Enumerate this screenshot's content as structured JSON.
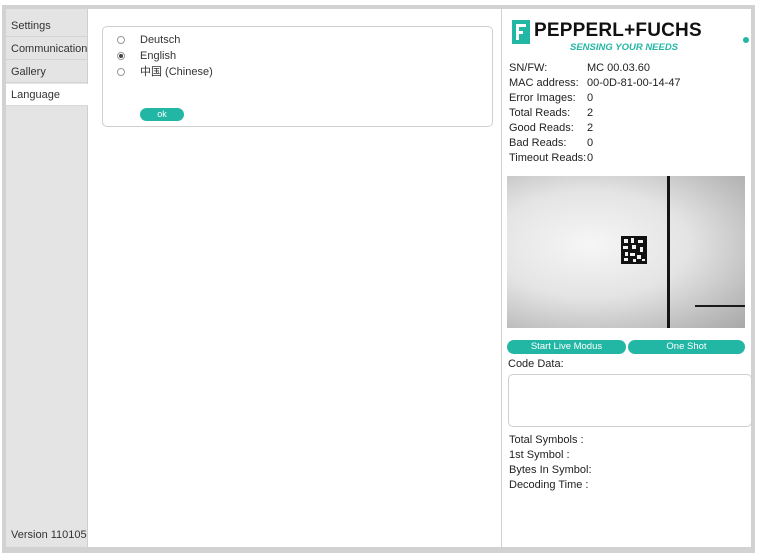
{
  "sidebar": {
    "items": [
      {
        "label": "Settings"
      },
      {
        "label": "Communication"
      },
      {
        "label": "Gallery"
      },
      {
        "label": "Language",
        "active": true
      }
    ],
    "version": "Version 110105"
  },
  "language": {
    "options": [
      {
        "label": "Deutsch",
        "selected": false
      },
      {
        "label": "English",
        "selected": true
      },
      {
        "label": "中国 (Chinese)",
        "selected": false
      }
    ],
    "ok_label": "ok"
  },
  "brand": {
    "name": "PEPPERL+FUCHS",
    "tagline": "SENSING YOUR NEEDS",
    "accent": "#22b7a4",
    "logo_icon": "pf-logo-icon",
    "status_icon": "status-dot-icon"
  },
  "device_info": [
    {
      "key": "SN/FW:",
      "value": "MC 00.03.60"
    },
    {
      "key": "MAC address:",
      "value": "00-0D-81-00-14-47"
    },
    {
      "key": "Error Images:",
      "value": "0"
    },
    {
      "key": "Total Reads:",
      "value": "2"
    },
    {
      "key": "Good Reads:",
      "value": "2"
    },
    {
      "key": "Bad Reads:",
      "value": "0"
    },
    {
      "key": "Timeout Reads:",
      "value": "0"
    }
  ],
  "controls": {
    "live_label": "Start Live Modus",
    "oneshot_label": "One Shot"
  },
  "code": {
    "label": "Code Data:",
    "value": ""
  },
  "symbol_stats": [
    {
      "label": "Total Symbols :"
    },
    {
      "label": "1st Symbol :"
    },
    {
      "label": "Bytes In Symbol:"
    },
    {
      "label": "Decoding Time :"
    }
  ]
}
